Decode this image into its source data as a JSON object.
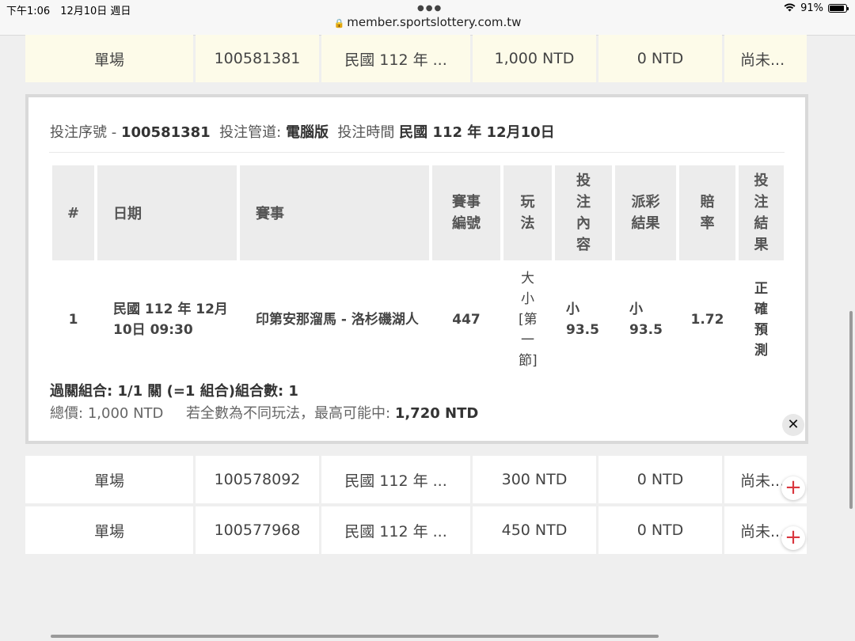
{
  "status_bar": {
    "time": "下午1:06　12月10日 週日",
    "battery": "91%",
    "battery_level": 0.91,
    "url": "member.sportslottery.com.tw"
  },
  "rows_top": [
    {
      "type": "單場",
      "serial": "100581381",
      "date": "民國 112 年 ...",
      "amount": "1,000 NTD",
      "payout": "0 NTD",
      "status": "尚未..."
    }
  ],
  "detail": {
    "serial_label": "投注序號",
    "serial_sep": "-",
    "serial": "100581381",
    "channel_label": "投注管道:",
    "channel": "電腦版",
    "time_label": "投注時間",
    "time": "民國 112 年 12月10日",
    "headers": {
      "num": "#",
      "date": "日期",
      "event": "賽事",
      "event_no": "賽事編號",
      "play": "玩法",
      "content": "投注內容",
      "result": "派彩結果",
      "odds": "賠率",
      "bet_result": "投注結果"
    },
    "bets": [
      {
        "num": "1",
        "date": "民國 112 年 12月10日 09:30",
        "event": "印第安那溜馬 - 洛杉磯湖人",
        "event_no": "447",
        "play": "大小[第一節]",
        "content": "小 93.5",
        "result": "小 93.5",
        "odds": "1.72",
        "bet_result": "正確預測"
      }
    ],
    "combo": "過關組合: 1/1 關 (=1 組合)組合數: 1",
    "total_label": "總價:",
    "total": "1,000 NTD",
    "max_label": "若全數為不同玩法，最高可能中:",
    "max": "1,720 NTD"
  },
  "rows_bottom": [
    {
      "type": "單場",
      "serial": "100578092",
      "date": "民國 112 年 ...",
      "amount": "300 NTD",
      "payout": "0 NTD",
      "status": "尚未..."
    },
    {
      "type": "單場",
      "serial": "100577968",
      "date": "民國 112 年 ...",
      "amount": "450 NTD",
      "payout": "0 NTD",
      "status": "尚未..."
    }
  ],
  "icons": {
    "lock": "lock-icon",
    "wifi": "wifi-icon",
    "close": "close-icon",
    "expand": "plus-icon"
  },
  "colors": {
    "highlight_row": "#fdfbe9",
    "plus": "#d9363e",
    "header_bg": "#ececec"
  }
}
